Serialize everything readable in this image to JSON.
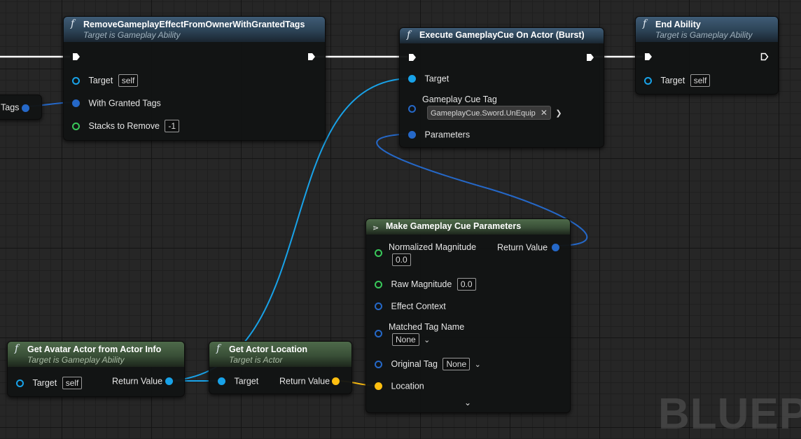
{
  "watermark": "BLUEPR",
  "nodes": {
    "remove_effect": {
      "title": "RemoveGameplayEffectFromOwnerWithGrantedTags",
      "subtitle": "Target is Gameplay Ability",
      "pins": {
        "target_label": "Target",
        "target_value": "self",
        "tags_label": "With Granted Tags",
        "stacks_label": "Stacks to Remove",
        "stacks_value": "-1"
      }
    },
    "execute_cue": {
      "title": "Execute GameplayCue On Actor (Burst)",
      "pins": {
        "target_label": "Target",
        "cue_tag_label": "Gameplay Cue Tag",
        "cue_tag_value": "GameplayCue.Sword.UnEquip",
        "parameters_label": "Parameters"
      }
    },
    "end_ability": {
      "title": "End Ability",
      "subtitle": "Target is Gameplay Ability",
      "pins": {
        "target_label": "Target",
        "target_value": "self"
      }
    },
    "make_params": {
      "title": "Make Gameplay Cue Parameters",
      "pins": {
        "normalized_magnitude_label": "Normalized Magnitude",
        "normalized_magnitude_value": "0.0",
        "return_value_label": "Return Value",
        "raw_magnitude_label": "Raw Magnitude",
        "raw_magnitude_value": "0.0",
        "effect_context_label": "Effect Context",
        "matched_tag_name_label": "Matched Tag Name",
        "matched_tag_name_value": "None",
        "original_tag_label": "Original Tag",
        "original_tag_value": "None",
        "location_label": "Location"
      }
    },
    "get_avatar": {
      "title": "Get Avatar Actor from Actor Info",
      "subtitle": "Target is Gameplay Ability",
      "pins": {
        "target_label": "Target",
        "target_value": "self",
        "return_value_label": "Return Value"
      }
    },
    "get_location": {
      "title": "Get Actor Location",
      "subtitle": "Target is Actor",
      "pins": {
        "target_label": "Target",
        "return_value_label": "Return Value"
      }
    },
    "left_partial": {
      "tags_label": "Tags"
    }
  },
  "colors": {
    "object_pin": "#18a2e8",
    "struct_pin": "#2568c8",
    "float_pin": "#39c85a",
    "vector_pin": "#ffbf10",
    "exec_wire": "#ffffff"
  },
  "icons": {
    "function": "function-icon",
    "struct": "struct-icon",
    "exec": "exec-pin-icon",
    "chevron": "chevron-down-icon",
    "clear": "close-icon"
  }
}
